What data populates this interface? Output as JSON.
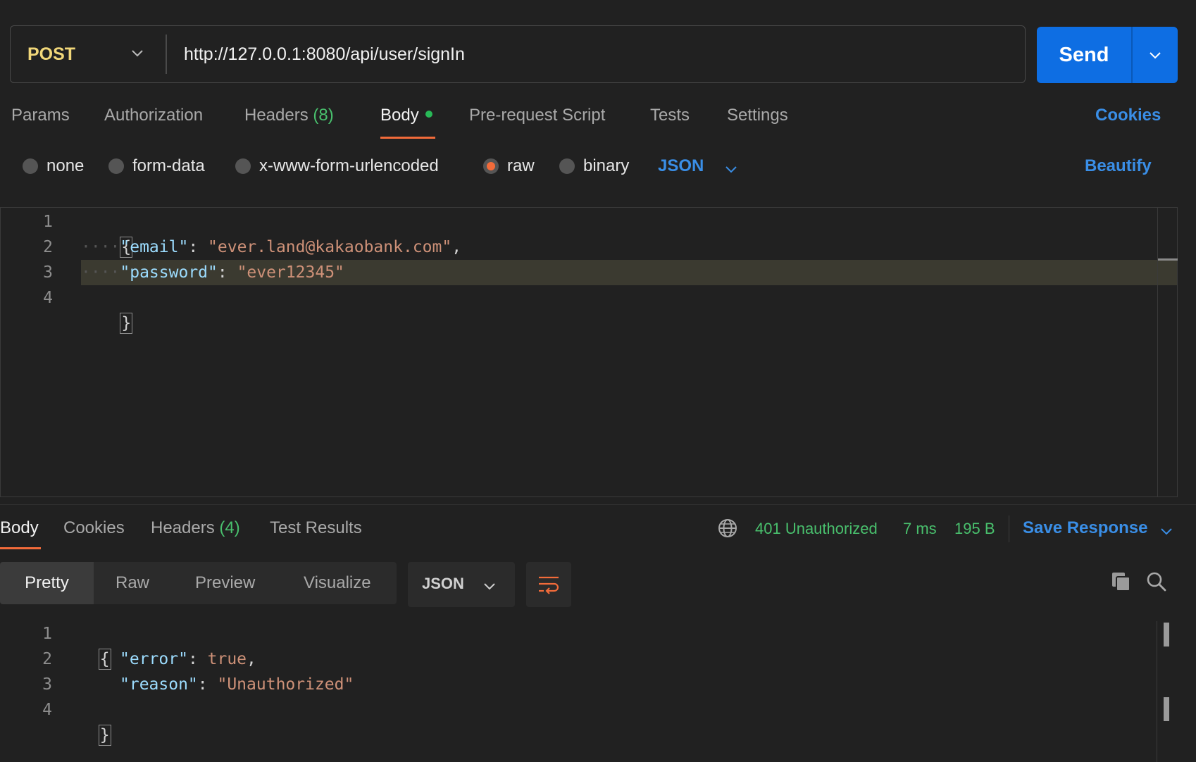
{
  "request": {
    "method": "POST",
    "url": "http://127.0.0.1:8080/api/user/signIn",
    "send_label": "Send"
  },
  "request_tabs": {
    "params": "Params",
    "authorization": "Authorization",
    "headers": "Headers",
    "headers_count": "(8)",
    "body": "Body",
    "prerequest": "Pre-request Script",
    "tests": "Tests",
    "settings": "Settings",
    "cookies": "Cookies"
  },
  "body_modes": {
    "none": "none",
    "form_data": "form-data",
    "urlencoded": "x-www-form-urlencoded",
    "raw": "raw",
    "binary": "binary",
    "selected": "raw",
    "language": "JSON",
    "beautify": "Beautify"
  },
  "request_body": {
    "line_numbers": [
      "1",
      "2",
      "3",
      "4"
    ],
    "open_brace": "{",
    "close_brace": "}",
    "indent": "····",
    "email_key": "\"email\"",
    "email_value": "\"ever.land@kakaobank.com\"",
    "password_key": "\"password\"",
    "password_value": "\"ever12345\""
  },
  "response_tabs": {
    "body": "Body",
    "cookies": "Cookies",
    "headers": "Headers",
    "headers_count": "(4)",
    "test_results": "Test Results"
  },
  "response_meta": {
    "status": "401 Unauthorized",
    "time": "7 ms",
    "size": "195 B",
    "save_response": "Save Response",
    "status_color": "#49c06d"
  },
  "view_modes": {
    "pretty": "Pretty",
    "raw": "Raw",
    "preview": "Preview",
    "visualize": "Visualize",
    "format": "JSON"
  },
  "response_body": {
    "line_numbers": [
      "1",
      "2",
      "3",
      "4"
    ],
    "open_brace": "{",
    "close_brace": "}",
    "error_key": "\"error\"",
    "error_value": "true",
    "reason_key": "\"reason\"",
    "reason_value": "\"Unauthorized\""
  },
  "colors": {
    "accent": "#f26b3a",
    "link": "#3a8ee6",
    "send": "#0e6ee3",
    "method": "#f1d779"
  }
}
